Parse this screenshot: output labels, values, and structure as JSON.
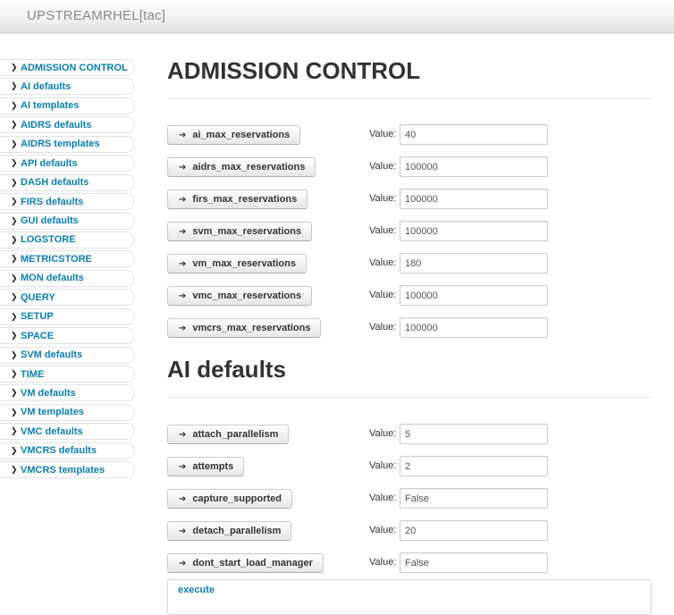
{
  "app": {
    "title": "UPSTREAMRHEL[tac]"
  },
  "sidebar": {
    "items": [
      {
        "label": "ADMISSION CONTROL"
      },
      {
        "label": "AI defaults"
      },
      {
        "label": "AI templates"
      },
      {
        "label": "AIDRS defaults"
      },
      {
        "label": "AIDRS templates"
      },
      {
        "label": "API defaults"
      },
      {
        "label": "DASH defaults"
      },
      {
        "label": "FIRS defaults"
      },
      {
        "label": "GUI defaults"
      },
      {
        "label": "LOGSTORE"
      },
      {
        "label": "METRICSTORE"
      },
      {
        "label": "MON defaults"
      },
      {
        "label": "QUERY"
      },
      {
        "label": "SETUP"
      },
      {
        "label": "SPACE"
      },
      {
        "label": "SVM defaults"
      },
      {
        "label": "TIME"
      },
      {
        "label": "VM defaults"
      },
      {
        "label": "VM templates"
      },
      {
        "label": "VMC defaults"
      },
      {
        "label": "VMCRS defaults"
      },
      {
        "label": "VMCRS templates"
      }
    ]
  },
  "sections": {
    "admission_control": {
      "title": "ADMISSION CONTROL",
      "value_label": "Value:",
      "params": [
        {
          "name": "ai_max_reservations",
          "value": "40"
        },
        {
          "name": "aidrs_max_reservations",
          "value": "100000"
        },
        {
          "name": "firs_max_reservations",
          "value": "100000"
        },
        {
          "name": "svm_max_reservations",
          "value": "100000"
        },
        {
          "name": "vm_max_reservations",
          "value": "180"
        },
        {
          "name": "vmc_max_reservations",
          "value": "100000"
        },
        {
          "name": "vmcrs_max_reservations",
          "value": "100000"
        }
      ]
    },
    "ai_defaults": {
      "title": "AI defaults",
      "value_label": "Value:",
      "params": [
        {
          "name": "attach_parallelism",
          "value": "5"
        },
        {
          "name": "attempts",
          "value": "2"
        },
        {
          "name": "capture_supported",
          "value": "False"
        },
        {
          "name": "detach_parallelism",
          "value": "20"
        },
        {
          "name": "dont_start_load_manager",
          "value": "False"
        }
      ]
    }
  },
  "execute": {
    "label": "execute"
  },
  "icons": {
    "sidebar_chevron": "chevron-right-icon",
    "param_arrow": "arrow-right-icon"
  },
  "colors": {
    "link": "#0a7fb0",
    "heading": "#333333",
    "topbar_text": "#8a8a8a"
  }
}
